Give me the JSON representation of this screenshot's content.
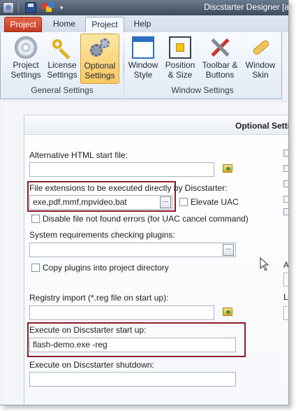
{
  "titlebar": {
    "app_title": "Discstarter Designer [a",
    "dropdown_glyph": "▾"
  },
  "tabs": [
    {
      "label": "Project"
    },
    {
      "label": "Home"
    },
    {
      "label": "Project"
    },
    {
      "label": "Help"
    }
  ],
  "ribbon": {
    "general_settings": {
      "label": "General Settings",
      "buttons": [
        {
          "line1": "Project",
          "line2": "Settings",
          "icon": "cd-icon"
        },
        {
          "line1": "License",
          "line2": "Settings",
          "icon": "key-icon"
        },
        {
          "line1": "Optional",
          "line2": "Settings",
          "icon": "gear-icon",
          "active": true
        }
      ]
    },
    "window_settings": {
      "label": "Window Settings",
      "buttons": [
        {
          "line1": "Window",
          "line2": "Style",
          "icon": "window-icon"
        },
        {
          "line1": "Position",
          "line2": "& Size",
          "icon": "position-icon"
        },
        {
          "line1": "Toolbar &",
          "line2": "Buttons",
          "icon": "tools-icon"
        },
        {
          "line1": "Window",
          "line2": "Skin",
          "icon": "bandage-icon"
        }
      ]
    }
  },
  "panel": {
    "title": "Optional Settin",
    "alt_html": {
      "label": "Alternative HTML start file:",
      "value": ""
    },
    "file_ext": {
      "label": "File extensions to be executed directly by Discstarter:",
      "value": "exe,pdf,mmf,mpvideo,bat",
      "browse": "..."
    },
    "elevate_uac": {
      "label": "Elevate UAC",
      "checked": false
    },
    "disable_errors": {
      "label": "Disable file not found errors (for UAC cancel command)",
      "checked": false
    },
    "sysreq": {
      "label": "System requirements checking plugins:",
      "value": "",
      "browse": "..."
    },
    "copy_plugins": {
      "label": "Copy plugins into project directory",
      "checked": false
    },
    "registry": {
      "label": "Registry import (*.reg file on start up):",
      "value": ""
    },
    "exec_start": {
      "label": "Execute on Discstarter start up:",
      "value": "flash-demo.exe -reg"
    },
    "exec_shutdown": {
      "label": "Execute on Discstarter shutdown:",
      "value": ""
    },
    "right_partial": {
      "label_a": "A",
      "label_l": "L"
    }
  },
  "colors": {
    "highlight_border": "#8c1d2a",
    "app_tab": "#d84a30",
    "active_button": "#f7c85e"
  }
}
